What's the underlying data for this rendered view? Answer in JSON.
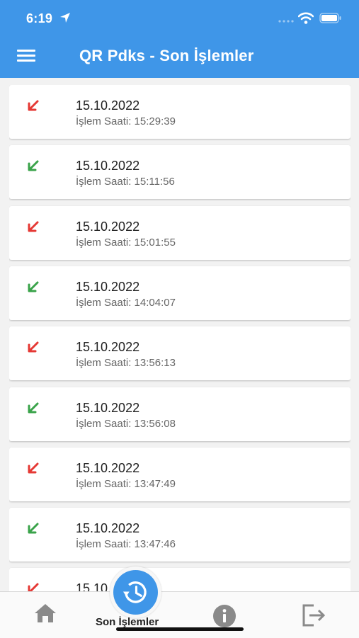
{
  "status_bar": {
    "time": "6:19"
  },
  "app_bar": {
    "title": "QR Pdks - Son İşlemler"
  },
  "records": [
    {
      "direction": "exit",
      "date": "15.10.2022",
      "time_text": "İşlem Saati: 15:29:39"
    },
    {
      "direction": "entry",
      "date": "15.10.2022",
      "time_text": "İşlem Saati: 15:11:56"
    },
    {
      "direction": "exit",
      "date": "15.10.2022",
      "time_text": "İşlem Saati: 15:01:55"
    },
    {
      "direction": "entry",
      "date": "15.10.2022",
      "time_text": "İşlem Saati: 14:04:07"
    },
    {
      "direction": "exit",
      "date": "15.10.2022",
      "time_text": "İşlem Saati: 13:56:13"
    },
    {
      "direction": "entry",
      "date": "15.10.2022",
      "time_text": "İşlem Saati: 13:56:08"
    },
    {
      "direction": "exit",
      "date": "15.10.2022",
      "time_text": "İşlem Saati: 13:47:49"
    },
    {
      "direction": "entry",
      "date": "15.10.2022",
      "time_text": "İşlem Saati: 13:47:46"
    },
    {
      "direction": "exit",
      "date": "15.10",
      "time_text": ""
    }
  ],
  "colors": {
    "accent": "#3f96e8",
    "entry": "#3aa34a",
    "exit": "#e53935"
  },
  "bottom_nav": {
    "active_label": "Son İşlemler",
    "items": [
      "home-icon",
      "history-icon",
      "info-icon",
      "logout-icon"
    ]
  }
}
